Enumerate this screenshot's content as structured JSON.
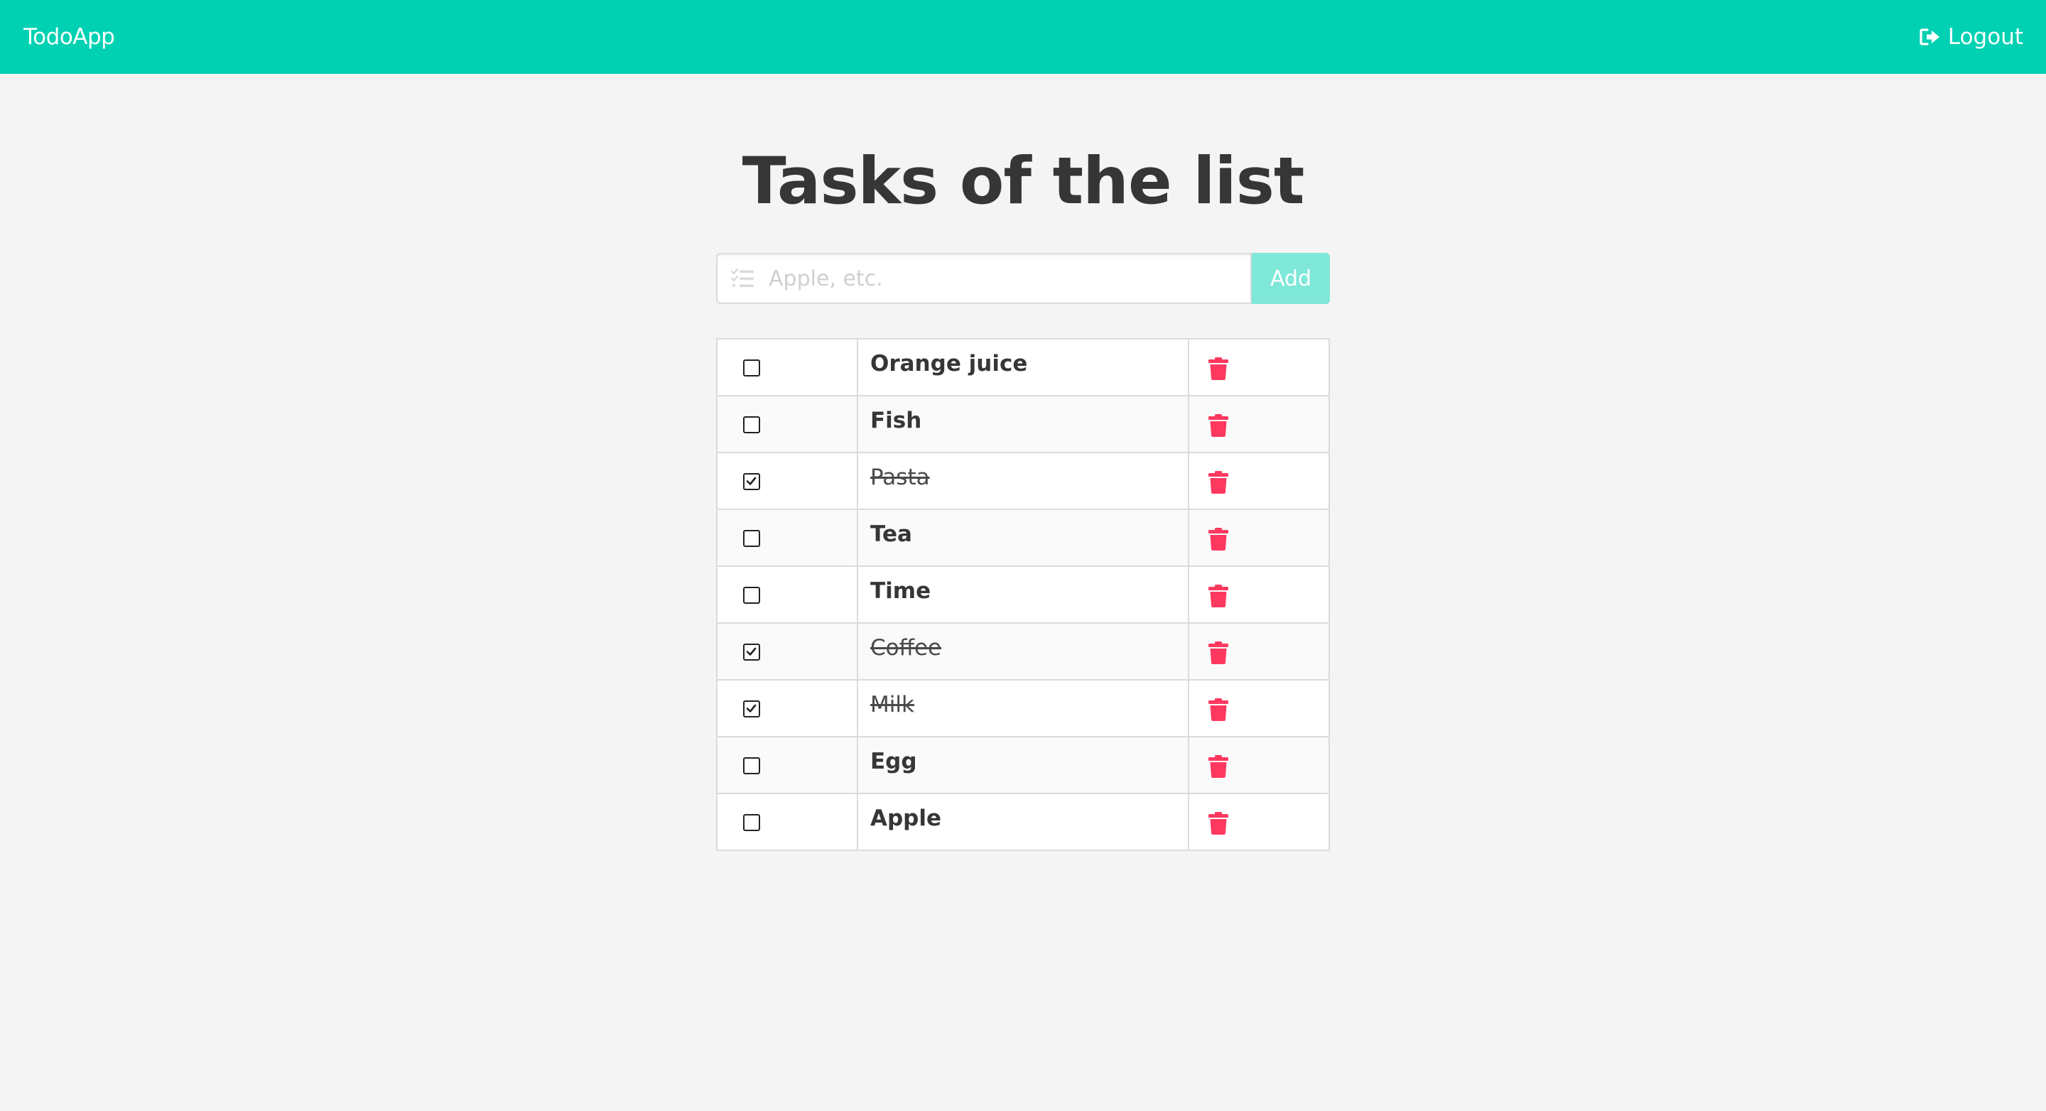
{
  "navbar": {
    "brand": "TodoApp",
    "logout_label": "Logout"
  },
  "page": {
    "title": "Tasks of the list"
  },
  "form": {
    "placeholder": "Apple, etc.",
    "value": "",
    "add_label": "Add"
  },
  "colors": {
    "primary": "#00d1b2",
    "add_button": "#7fe8d8",
    "delete_icon": "#ff3860",
    "background": "#f4f4f4"
  },
  "icons": {
    "input": "tasks-list-icon",
    "logout": "sign-out-icon",
    "delete": "trash-icon",
    "checkbox": "checkbox-icon"
  },
  "tasks": [
    {
      "name": "Orange juice",
      "done": false
    },
    {
      "name": "Fish",
      "done": false
    },
    {
      "name": "Pasta",
      "done": true
    },
    {
      "name": "Tea",
      "done": false
    },
    {
      "name": "Time",
      "done": false
    },
    {
      "name": "Coffee",
      "done": true
    },
    {
      "name": "Milk",
      "done": true
    },
    {
      "name": "Egg",
      "done": false
    },
    {
      "name": "Apple",
      "done": false
    }
  ]
}
